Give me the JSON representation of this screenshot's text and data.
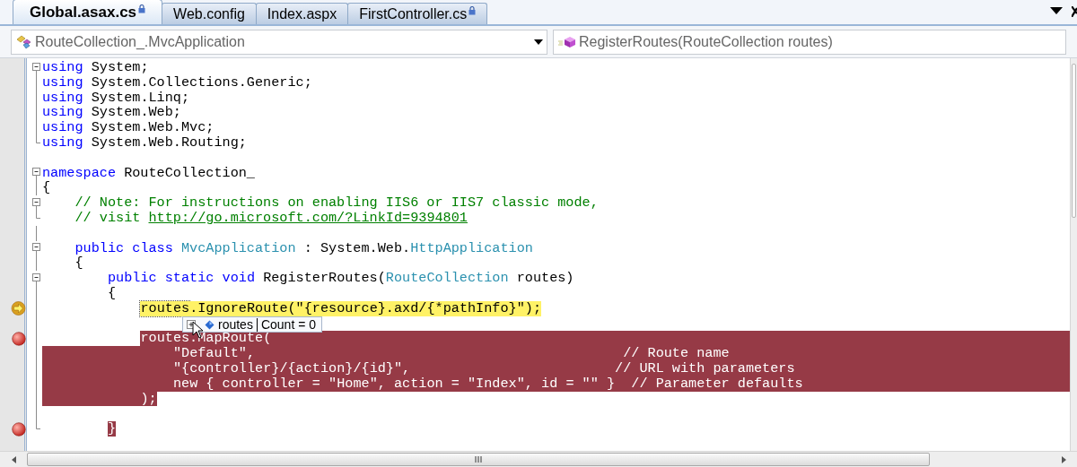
{
  "tabs": [
    {
      "label": "Global.asax.cs",
      "selected": true,
      "locked": true
    },
    {
      "label": "Web.config",
      "selected": false,
      "locked": false
    },
    {
      "label": "Index.aspx",
      "selected": false,
      "locked": false
    },
    {
      "label": "FirstController.cs",
      "selected": false,
      "locked": true
    }
  ],
  "navigation": {
    "type_combo": "RouteCollection_.MvcApplication",
    "member_combo": "RegisterRoutes(RouteCollection routes)"
  },
  "lines": [
    {
      "kind": "fold-start",
      "segments": [
        {
          "kind": "keyword",
          "text": "using"
        },
        {
          "kind": "plain",
          "text": " System;"
        }
      ]
    },
    {
      "kind": "fold-inner",
      "segments": [
        {
          "kind": "keyword",
          "text": "using"
        },
        {
          "kind": "plain",
          "text": " System.Collections.Generic;"
        }
      ]
    },
    {
      "kind": "fold-inner",
      "segments": [
        {
          "kind": "keyword",
          "text": "using"
        },
        {
          "kind": "plain",
          "text": " System.Linq;"
        }
      ]
    },
    {
      "kind": "fold-inner",
      "segments": [
        {
          "kind": "keyword",
          "text": "using"
        },
        {
          "kind": "plain",
          "text": " System.Web;"
        }
      ]
    },
    {
      "kind": "fold-inner",
      "segments": [
        {
          "kind": "keyword",
          "text": "using"
        },
        {
          "kind": "plain",
          "text": " System.Web.Mvc;"
        }
      ]
    },
    {
      "kind": "fold-end",
      "segments": [
        {
          "kind": "keyword",
          "text": "using"
        },
        {
          "kind": "plain",
          "text": " System.Web.Routing;"
        }
      ]
    },
    {
      "kind": "gap"
    },
    {
      "kind": "fold-start",
      "segments": [
        {
          "kind": "keyword",
          "text": "namespace"
        },
        {
          "kind": "plain",
          "text": " RouteCollection_"
        }
      ]
    },
    {
      "kind": "fold-inner",
      "segments": [
        {
          "kind": "plain",
          "text": "{"
        }
      ]
    },
    {
      "children": [
        {
          "kind": "fold-start",
          "segments": [
            {
              "kind": "comment",
              "text": "// Note: For instructions on enabling IIS6 or IIS7 classic mode,"
            }
          ]
        },
        {
          "kind": "fold-end",
          "segments": [
            {
              "kind": "comment",
              "text": "// visit "
            },
            {
              "kind": "link",
              "text": "http://go.microsoft.com/?LinkId=9394801"
            }
          ]
        },
        {
          "kind": "fold-inner"
        },
        {
          "kind": "fold-start",
          "segments": [
            {
              "kind": "keyword",
              "text": "public class "
            },
            {
              "kind": "type",
              "text": "MvcApplication"
            },
            {
              "kind": "plain",
              "text": " : System.Web."
            },
            {
              "kind": "type",
              "text": "HttpApplication"
            }
          ]
        },
        {
          "kind": "fold-inner",
          "segments": [
            {
              "kind": "plain",
              "text": "{"
            }
          ]
        },
        {
          "children": [
            {
              "kind": "fold-start",
              "segments": [
                {
                  "kind": "keyword",
                  "text": "public static void"
                },
                {
                  "kind": "plain",
                  "text": " RegisterRoutes("
                },
                {
                  "kind": "type",
                  "text": "RouteCollection"
                },
                {
                  "kind": "plain",
                  "text": " routes)"
                }
              ]
            },
            {
              "kind": "fold-inner",
              "segments": [
                {
                  "kind": "plain",
                  "text": "{"
                }
              ]
            },
            {
              "children": [
                {
                  "kind": "fold-inner",
                  "current_glyph": true,
                  "current_span": true,
                  "fill_from_margin": false,
                  "fill_to_edge": false,
                  "segments": [
                    {
                      "kind": "hovered",
                      "text": "routes"
                    },
                    {
                      "text": ".IgnoreRoute(\"{resource}.axd/{*pathInfo}\");"
                    }
                  ]
                },
                {
                  "kind": "fold-inner"
                },
                {
                  "kind": "fold-inner",
                  "breakpoint_glyph": true,
                  "breakpoint_span": true,
                  "fill_from_margin": false,
                  "fill_to_edge": true,
                  "segments": [
                    {
                      "text": "routes.MapRoute("
                    }
                  ]
                },
                {
                  "children": [
                    {
                      "kind": "fold-inner",
                      "breakpoint_span": true,
                      "fill_from_margin": true,
                      "fill_to_edge": true,
                      "segments": [
                        {
                          "text": "\"Default\",                                             // Route name"
                        }
                      ]
                    },
                    {
                      "kind": "fold-inner",
                      "breakpoint_span": true,
                      "fill_from_margin": true,
                      "fill_to_edge": true,
                      "segments": [
                        {
                          "text": "\"{controller}/{action}/{id}\",                         // URL with parameters"
                        }
                      ]
                    },
                    {
                      "kind": "fold-inner",
                      "breakpoint_span": true,
                      "fill_from_margin": true,
                      "fill_to_edge": true,
                      "segments": [
                        {
                          "text": "new { controller = \"Home\", action = \"Index\", id = \"\" }  // Parameter defaults"
                        }
                      ]
                    }
                  ]
                },
                {
                  "kind": "fold-inner",
                  "breakpoint_span": true,
                  "fill_from_margin": true,
                  "fill_to_edge": false,
                  "segments": [
                    {
                      "text": ");"
                    }
                  ]
                },
                {
                  "kind": "fold-inner"
                }
              ]
            },
            {
              "kind": "fold-end",
              "breakpoint_glyph": true,
              "breakpoint_span": true,
              "fill_from_margin": false,
              "fill_to_edge": false,
              "segments": [
                {
                  "text": "}"
                }
              ]
            }
          ]
        }
      ]
    }
  ],
  "datatip": {
    "name": "routes",
    "value": "Count = 0"
  }
}
